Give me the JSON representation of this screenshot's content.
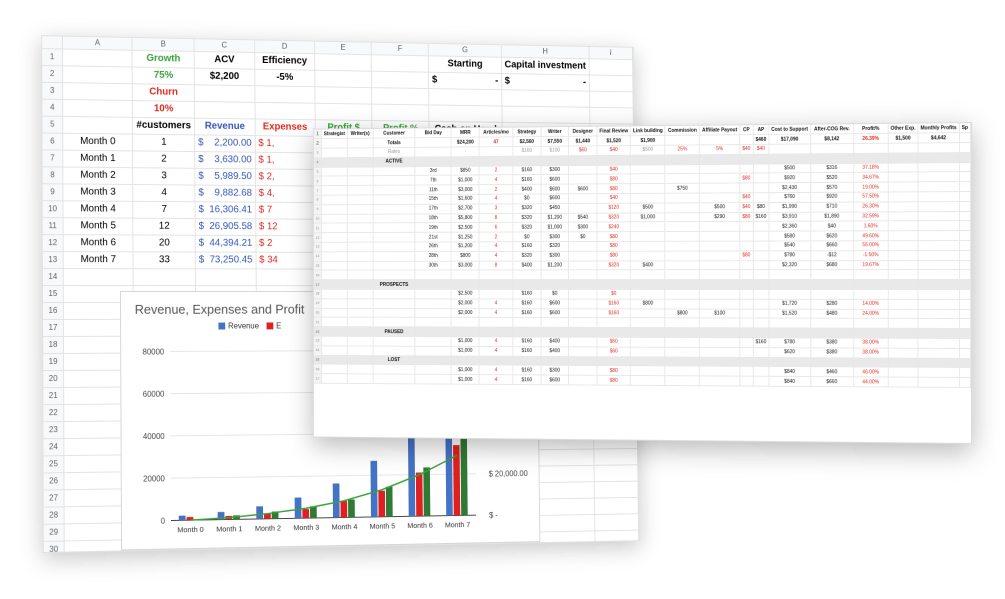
{
  "back_sheet": {
    "columns": [
      "A",
      "B",
      "C",
      "D",
      "E",
      "F",
      "G",
      "H",
      "I"
    ],
    "header": {
      "growth_label": "Growth",
      "growth_value": "75%",
      "churn_label": "Churn",
      "churn_value": "10%",
      "acv_label": "ACV",
      "acv_value": "$2,200",
      "efficiency_label": "Efficiency",
      "efficiency_value": "-5%",
      "starting_label": "Starting",
      "starting_value": "$",
      "starting_dash": "-",
      "capital_label": "Capital investment",
      "capital_value": "$",
      "capital_dash": "-"
    },
    "table_headers": {
      "customers": "#customers",
      "revenue": "Revenue",
      "expenses": "Expenses",
      "profit_dollar": "Profit $",
      "profit_pct": "Profit %",
      "cash": "Cash on Hand"
    },
    "rows": [
      {
        "month": "Month 0",
        "customers": "1",
        "revenue": "2,200.00",
        "expenses": "1,"
      },
      {
        "month": "Month 1",
        "customers": "2",
        "revenue": "3,630.00",
        "expenses": "1,"
      },
      {
        "month": "Month 2",
        "customers": "3",
        "revenue": "5,989.50",
        "expenses": "2,"
      },
      {
        "month": "Month 3",
        "customers": "4",
        "revenue": "9,882.68",
        "expenses": "4,"
      },
      {
        "month": "Month 4",
        "customers": "7",
        "revenue": "16,306.41",
        "expenses": "7"
      },
      {
        "month": "Month 5",
        "customers": "12",
        "revenue": "26,905.58",
        "expenses": "12"
      },
      {
        "month": "Month 6",
        "customers": "20",
        "revenue": "44,394.21",
        "expenses": "2"
      },
      {
        "month": "Month 7",
        "customers": "33",
        "revenue": "73,250.45",
        "expenses": "34"
      }
    ],
    "row_numbers": [
      "1",
      "2",
      "3",
      "4",
      "5",
      "6",
      "7",
      "8",
      "9",
      "10",
      "11",
      "12",
      "13",
      "14",
      "15",
      "16",
      "17",
      "18",
      "19",
      "20",
      "21",
      "22",
      "23",
      "24",
      "25",
      "26",
      "27",
      "28",
      "29",
      "30"
    ]
  },
  "chart_data": {
    "type": "bar",
    "title": "Revenue, Expenses and Profit",
    "categories": [
      "Month 0",
      "Month 1",
      "Month 2",
      "Month 3",
      "Month 4",
      "Month 5",
      "Month 6",
      "Month 7"
    ],
    "series": [
      {
        "name": "Revenue",
        "values": [
          2200,
          3630,
          5990,
          9883,
          16306,
          26906,
          44394,
          73250
        ],
        "color": "#4472c4"
      },
      {
        "name": "E",
        "values": [
          1500,
          1700,
          2600,
          4300,
          7800,
          12500,
          21000,
          34000
        ],
        "color": "#e02020"
      },
      {
        "name": "",
        "values": [
          0,
          1900,
          3400,
          5600,
          8500,
          14400,
          23400,
          39250
        ],
        "color": "#2f7a35"
      }
    ],
    "line": {
      "values": [
        0,
        900,
        2500,
        4700,
        8000,
        13000,
        20000,
        29000
      ],
      "color": "#3aa13a"
    },
    "y_ticks": [
      "0",
      "20000",
      "40000",
      "60000",
      "80000"
    ],
    "ylim": [
      0,
      80000
    ],
    "y2_ticks": [
      "$ -",
      "$ 20,000.00"
    ]
  },
  "front_sheet": {
    "headers": [
      "Strategist",
      "Writer(s)",
      "Customer",
      "Bid Day",
      "MRR",
      "Articles/mo",
      "Strategy",
      "Writer",
      "Designer",
      "Final Review",
      "Link building",
      "Commission",
      "Affiliate Payout",
      "CP",
      "AP",
      "Cost to Support",
      "After-COG Rev.",
      "Profit%",
      "Other Exp.",
      "Monthly Profits",
      "Sp"
    ],
    "totals": {
      "label": "Totals",
      "mrr": "$24,200",
      "articles": "47",
      "strategy": "$2,560",
      "writer": "$7,550",
      "designer": "$1,440",
      "final": "$1,520",
      "link": "$1,900",
      "ap": "$460",
      "cost": "$17,090",
      "after": "$8,142",
      "profit": "26.39%",
      "other": "$1,500",
      "monthly": "$4,642"
    },
    "rates": {
      "label": "Rates",
      "dash": "-",
      "strategy": "$160",
      "writer": "$100",
      "designer": "$60",
      "final": "$40",
      "link": "$500",
      "commission": "25%",
      "affiliate": "5%",
      "cp": "$40",
      "ap": "$40"
    },
    "sections": {
      "active": "ACTIVE",
      "prospects": "PROSPECTS",
      "paused": "PAUSED",
      "lost": "LOST"
    },
    "active_rows": [
      [
        "3rd",
        "$850",
        "2",
        "$160",
        "$300",
        "",
        "$40",
        "",
        "",
        "",
        "",
        "",
        "$500",
        "$316",
        "37.18%"
      ],
      [
        "7th",
        "$1,000",
        "4",
        "$160",
        "$600",
        "",
        "$80",
        "",
        "",
        "",
        "$80",
        "",
        "$920",
        "$520",
        "34.67%"
      ],
      [
        "11th",
        "$3,000",
        "2",
        "$400",
        "$600",
        "$600",
        "$80",
        "",
        "$750",
        "",
        "",
        "",
        "$2,430",
        "$570",
        "19.00%"
      ],
      [
        "15th",
        "$1,600",
        "4",
        "$0",
        "$600",
        "",
        "$40",
        "",
        "",
        "",
        "$40",
        "",
        "$760",
        "$920",
        "57.50%"
      ],
      [
        "17th",
        "$2,700",
        "3",
        "$320",
        "$450",
        "",
        "$120",
        "$500",
        "",
        "$500",
        "$40",
        "$80",
        "$1,990",
        "$710",
        "26.30%"
      ],
      [
        "18th",
        "$5,800",
        "8",
        "$320",
        "$1,200",
        "$540",
        "$320",
        "$1,000",
        "",
        "$290",
        "$80",
        "$160",
        "$3,910",
        "$1,890",
        "32.59%"
      ],
      [
        "19th",
        "$2,500",
        "6",
        "$320",
        "$1,000",
        "$300",
        "$240",
        "",
        "",
        "",
        "",
        "",
        "$2,360",
        "$40",
        "1.60%"
      ],
      [
        "21st",
        "$1,250",
        "2",
        "$0",
        "$300",
        "$0",
        "$80",
        "",
        "",
        "",
        "",
        "",
        "$580",
        "$620",
        "49.60%"
      ],
      [
        "26th",
        "$1,200",
        "4",
        "$160",
        "$320",
        "",
        "$80",
        "",
        "",
        "",
        "",
        "",
        "$540",
        "$660",
        "55.00%"
      ],
      [
        "28th",
        "$800",
        "4",
        "$320",
        "$300",
        "",
        "$80",
        "",
        "",
        "",
        "$80",
        "",
        "$780",
        "-$12",
        "-1.50%"
      ],
      [
        "30th",
        "$3,000",
        "8",
        "$400",
        "$1,200",
        "",
        "$320",
        "$400",
        "",
        "",
        "",
        "",
        "$2,320",
        "$680",
        "19.67%"
      ]
    ],
    "prospect_rows": [
      [
        "",
        "$2,500",
        "",
        "$160",
        "$0",
        "",
        "$0",
        "",
        "",
        "",
        "",
        "",
        "",
        "",
        ""
      ],
      [
        "",
        "$2,000",
        "4",
        "$160",
        "$600",
        "",
        "$160",
        "$800",
        "",
        "",
        "",
        "",
        "$1,720",
        "$280",
        "14.00%"
      ],
      [
        "",
        "$2,000",
        "4",
        "$160",
        "$600",
        "",
        "$160",
        "",
        "$800",
        "$100",
        "",
        "",
        "$1,520",
        "$480",
        "24.00%"
      ]
    ],
    "paused_rows": [
      [
        "",
        "$1,000",
        "4",
        "$160",
        "$400",
        "",
        "$60",
        "",
        "",
        "",
        "",
        "$160",
        "$780",
        "$380",
        "38.00%"
      ],
      [
        "",
        "$1,000",
        "4",
        "$160",
        "$400",
        "",
        "$60",
        "",
        "",
        "",
        "",
        "",
        "$620",
        "$380",
        "38.00%"
      ]
    ],
    "lost_rows": [
      [
        "",
        "$1,000",
        "4",
        "$160",
        "$300",
        "",
        "$80",
        "",
        "",
        "",
        "",
        "",
        "$840",
        "$460",
        "46.00%"
      ],
      [
        "",
        "$1,000",
        "4",
        "$160",
        "$600",
        "",
        "$80",
        "",
        "",
        "",
        "",
        "",
        "$840",
        "$660",
        "44.00%"
      ]
    ]
  }
}
